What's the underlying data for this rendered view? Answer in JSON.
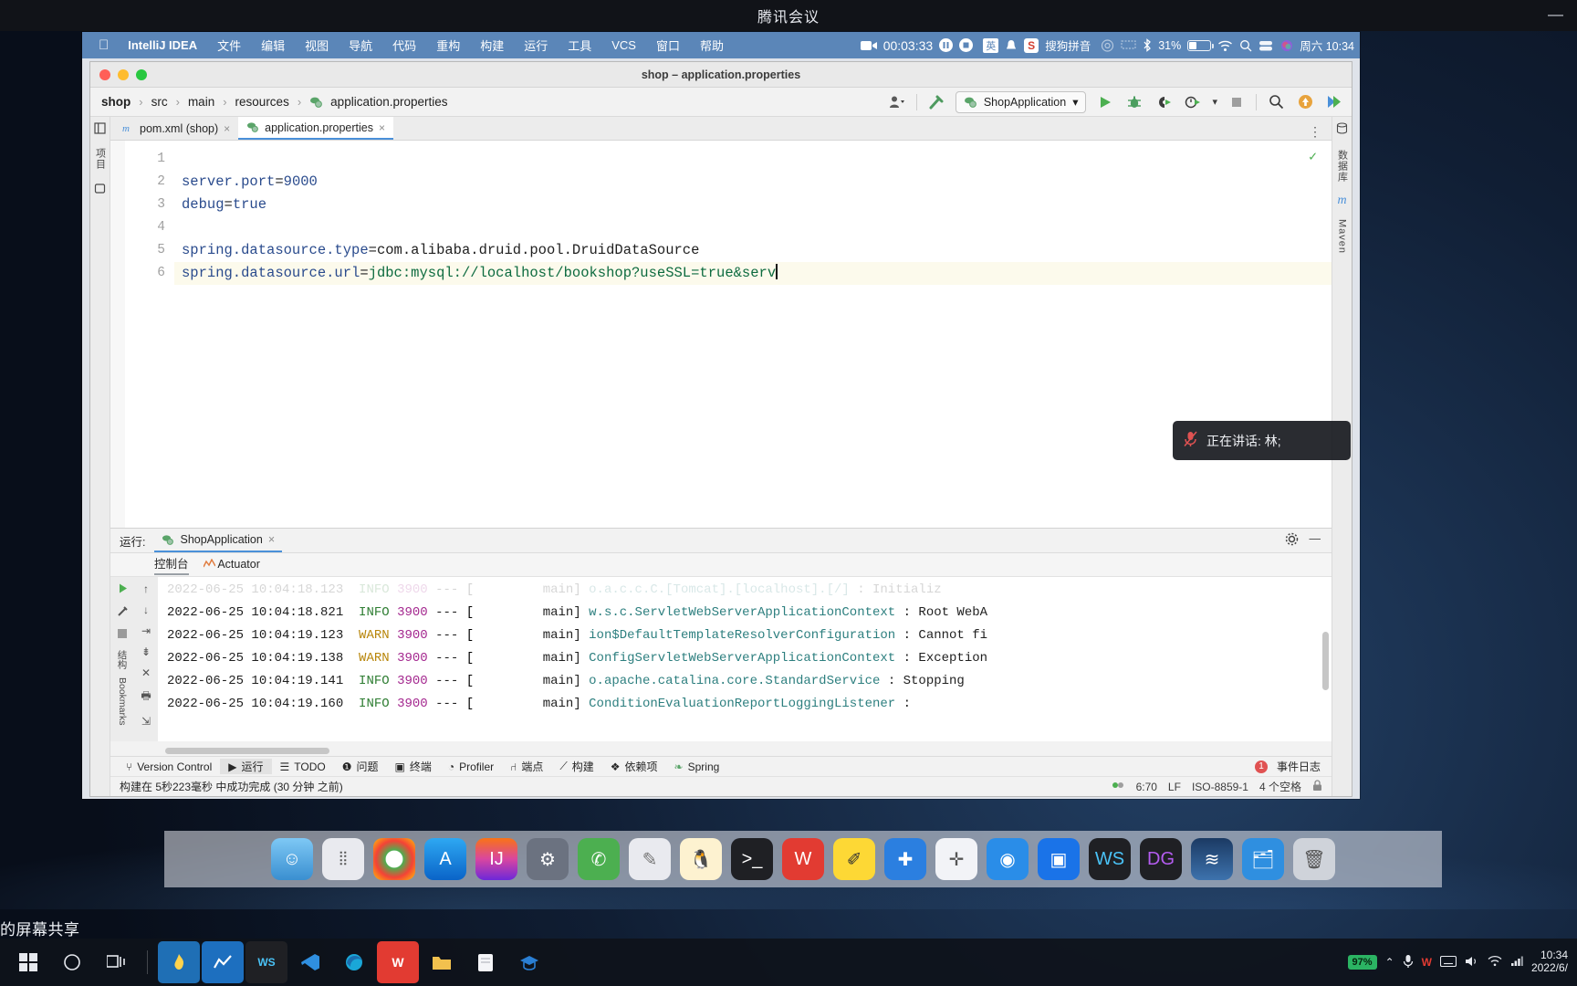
{
  "meeting": {
    "title": "腾讯会议",
    "minimize_label": "—",
    "share_label": "的屏幕共享",
    "speaking_toast": "正在讲话: 林;",
    "mic_icon": "microphone-muted-icon"
  },
  "mac_menubar": {
    "apple_logo": "",
    "app_name": "IntelliJ IDEA",
    "menus": [
      "文件",
      "编辑",
      "视图",
      "导航",
      "代码",
      "重构",
      "构建",
      "运行",
      "工具",
      "VCS",
      "窗口",
      "帮助"
    ],
    "recording_time": "00:03:33",
    "ime_label": "英",
    "sogou_label": "搜狗拼音",
    "battery_percent": "31%",
    "clock": "周六 10:34"
  },
  "idea": {
    "window_title": "shop – application.properties",
    "breadcrumb": [
      "shop",
      "src",
      "main",
      "resources",
      "application.properties"
    ],
    "breadcrumb_separator": "›",
    "run_config": "ShopApplication",
    "tabs": [
      {
        "label": "pom.xml (shop)",
        "icon": "maven-icon",
        "active": false
      },
      {
        "label": "application.properties",
        "icon": "properties-icon",
        "active": true
      }
    ],
    "tab_overflow": "⋮",
    "left_rail_label": "项目",
    "right_rail_labels": [
      "数据库",
      "Maven"
    ],
    "editor": {
      "line_numbers": [
        "1",
        "2",
        "3",
        "4",
        "5",
        "6"
      ],
      "lines": [
        {
          "key": "",
          "eq": "",
          "value": ""
        },
        {
          "key": "server.port",
          "eq": "=",
          "value": "9000"
        },
        {
          "key": "debug",
          "eq": "=",
          "value": "true"
        },
        {
          "key": "",
          "eq": "",
          "value": ""
        },
        {
          "key": "spring.datasource.type",
          "eq": "=",
          "value": "com.alibaba.druid.pool.DruidDataSource"
        },
        {
          "key": "spring.datasource.url",
          "eq": "=",
          "value": "jdbc:mysql://localhost/bookshop?useSSL=true&serv"
        }
      ],
      "inspection_status": "✓"
    },
    "run_window": {
      "title": "运行:",
      "tab_label": "ShopApplication",
      "close_label": "×",
      "settings_icon": "gear-icon",
      "minimize_icon": "minimize-icon",
      "subtabs": [
        {
          "label": "控制台",
          "active": true
        },
        {
          "label": "Actuator",
          "active": false,
          "icon": "actuator-icon"
        }
      ],
      "rail_label": "结构",
      "bookmarks_label": "Bookmarks",
      "log_lines": [
        {
          "ghost": true,
          "timestamp": "2022-06-25 10:04:18.123",
          "level": "INFO",
          "pid": "3900",
          "sep": "---",
          "thread": "main]",
          "logger": "o.a.c.c.C.[Tomcat].[localhost].[/]",
          "message": ": Initializ"
        },
        {
          "ghost": false,
          "timestamp": "2022-06-25 10:04:18.821",
          "level": "INFO",
          "pid": "3900",
          "sep": "---",
          "thread": "main]",
          "logger": "w.s.c.ServletWebServerApplicationContext",
          "message": ": Root WebA"
        },
        {
          "ghost": false,
          "timestamp": "2022-06-25 10:04:19.123",
          "level": "WARN",
          "pid": "3900",
          "sep": "---",
          "thread": "main]",
          "logger": "ion$DefaultTemplateResolverConfiguration",
          "message": ": Cannot fi"
        },
        {
          "ghost": false,
          "timestamp": "2022-06-25 10:04:19.138",
          "level": "WARN",
          "pid": "3900",
          "sep": "---",
          "thread": "main]",
          "logger": "ConfigServletWebServerApplicationContext",
          "message": ": Exception"
        },
        {
          "ghost": false,
          "timestamp": "2022-06-25 10:04:19.141",
          "level": "INFO",
          "pid": "3900",
          "sep": "---",
          "thread": "main]",
          "logger": "o.apache.catalina.core.StandardService",
          "message": ": Stopping"
        },
        {
          "ghost": false,
          "timestamp": "2022-06-25 10:04:19.160",
          "level": "INFO",
          "pid": "3900",
          "sep": "---",
          "thread": "main]",
          "logger": "ConditionEvaluationReportLoggingListener",
          "message": ":"
        }
      ]
    },
    "statusbar": {
      "items": [
        {
          "label": "Version Control",
          "icon": "branch-icon",
          "active": false
        },
        {
          "label": "运行",
          "icon": "play-icon",
          "active": true
        },
        {
          "label": "TODO",
          "icon": "list-icon",
          "active": false
        },
        {
          "label": "问题",
          "icon": "warning-icon",
          "active": false
        },
        {
          "label": "终端",
          "icon": "terminal-icon",
          "active": false
        },
        {
          "label": "Profiler",
          "icon": "profiler-icon",
          "active": false
        },
        {
          "label": "端点",
          "icon": "endpoints-icon",
          "active": false
        },
        {
          "label": "构建",
          "icon": "hammer-icon",
          "active": false
        },
        {
          "label": "依赖项",
          "icon": "layers-icon",
          "active": false
        },
        {
          "label": "Spring",
          "icon": "spring-leaf-icon",
          "active": false
        }
      ],
      "event_log": "事件日志",
      "event_badge": "1"
    },
    "buildbar": {
      "message": "构建在 5秒223毫秒 中成功完成 (30 分钟 之前)",
      "caret_position": "6:70",
      "line_separator": "LF",
      "encoding": "ISO-8859-1",
      "indent": "4 个空格",
      "lock_icon": "lock-icon",
      "inspection_icon": "inspection-icon"
    }
  },
  "windows_taskbar": {
    "start_icon": "start-icon",
    "search_icon": "search-circle-icon",
    "taskview_icon": "task-view-icon",
    "apps": [
      "flame-icon",
      "chart-icon",
      "webstorm-icon",
      "vscode-icon",
      "edge-icon",
      "wps-icon",
      "folder-icon",
      "note-icon",
      "graduate-icon"
    ],
    "battery_percent": "97%",
    "tray_icons": [
      "chevron-up-icon",
      "mic-icon",
      "wps-tray-icon",
      "keyboard-icon",
      "volume-icon",
      "wifi-icon",
      "network-icon"
    ],
    "clock_time": "10:34",
    "clock_date": "2022/6/"
  },
  "mac_dock": {
    "items": [
      "finder",
      "launchpad",
      "chrome",
      "appstore",
      "intellij",
      "settings",
      "wechat",
      "pencil",
      "qq",
      "terminal",
      "word",
      "sketch",
      "xcode",
      "tools",
      "meeting",
      "webstorm",
      "datagrip",
      "waves",
      "files",
      "trash"
    ]
  }
}
